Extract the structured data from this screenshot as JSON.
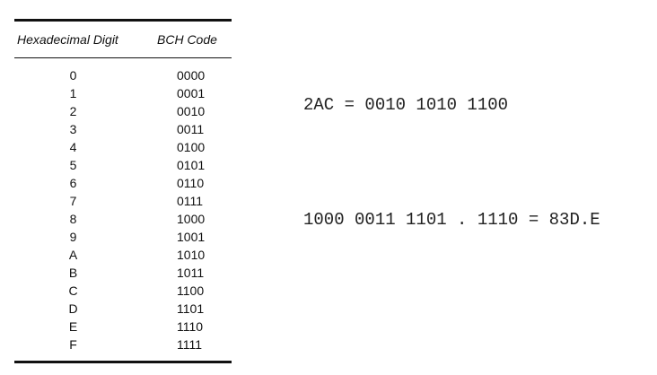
{
  "table": {
    "headers": {
      "hex": "Hexadecimal Digit",
      "bch": "BCH Code"
    },
    "rows": [
      {
        "hex": "0",
        "bch": "0000"
      },
      {
        "hex": "1",
        "bch": "0001"
      },
      {
        "hex": "2",
        "bch": "0010"
      },
      {
        "hex": "3",
        "bch": "0011"
      },
      {
        "hex": "4",
        "bch": "0100"
      },
      {
        "hex": "5",
        "bch": "0101"
      },
      {
        "hex": "6",
        "bch": "0110"
      },
      {
        "hex": "7",
        "bch": "0111"
      },
      {
        "hex": "8",
        "bch": "1000"
      },
      {
        "hex": "9",
        "bch": "1001"
      },
      {
        "hex": "A",
        "bch": "1010"
      },
      {
        "hex": "B",
        "bch": "1011"
      },
      {
        "hex": "C",
        "bch": "1100"
      },
      {
        "hex": "D",
        "bch": "1101"
      },
      {
        "hex": "E",
        "bch": "1110"
      },
      {
        "hex": "F",
        "bch": "1111"
      }
    ]
  },
  "examples": {
    "eq1": "2AC = 0010 1010 1100",
    "eq2": "1000 0011 1101 . 1110 = 83D.E"
  }
}
